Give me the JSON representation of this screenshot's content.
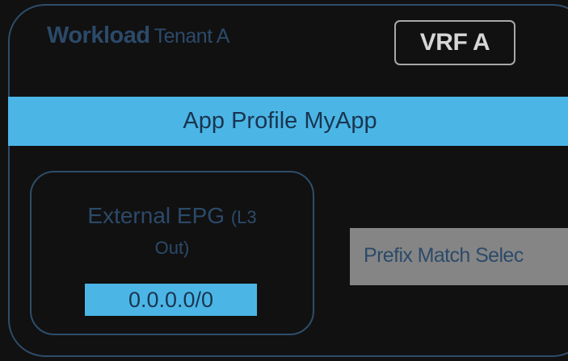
{
  "tenant": {
    "keyword": "Workload",
    "name": "Tenant A"
  },
  "vrf": {
    "label": "VRF A"
  },
  "app_profile": {
    "label": "App Profile MyApp"
  },
  "external_epg": {
    "title": "External EPG",
    "subtitle_open": "(L3",
    "subtitle_close": "Out)",
    "subnet": "0.0.0.0/0"
  },
  "selector": {
    "label": "Prefix Match Selec"
  },
  "colors": {
    "background": "#111111",
    "frame_border": "#2e4d6b",
    "text_blue": "#2c4a6a",
    "accent_blue": "#4bb6e6",
    "selector_gray": "#858585",
    "vrf_border": "#a8a8a8"
  }
}
